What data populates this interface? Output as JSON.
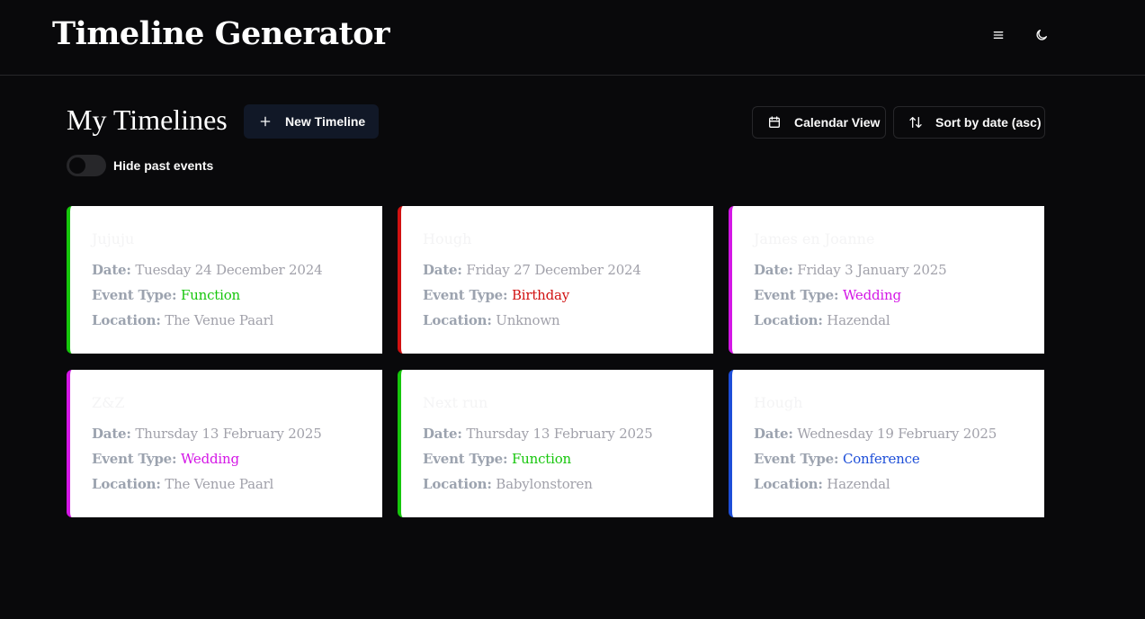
{
  "app": {
    "title": "Timeline Generator"
  },
  "header": {
    "menu_icon": "menu-icon",
    "theme_icon": "moon-icon"
  },
  "main": {
    "title": "My Timelines",
    "new_timeline_label": "New Timeline",
    "calendar_view_label": "Calendar View",
    "sort_label": "Sort by date (asc)",
    "hide_past_label": "Hide past events",
    "hide_past_checked": false
  },
  "labels": {
    "date": "Date:",
    "event_type": "Event Type:",
    "location": "Location:"
  },
  "colors": {
    "Function": "#16c60c",
    "Birthday": "#d11111",
    "Wedding": "#d417e6",
    "Conference": "#1d4ed8"
  },
  "cards": [
    {
      "title": "Jujuju",
      "date": "Tuesday 24 December 2024",
      "event_type": "Function",
      "location": "The Venue Paarl",
      "color": "#16c60c"
    },
    {
      "title": "Hough",
      "date": "Friday 27 December 2024",
      "event_type": "Birthday",
      "location": "Unknown",
      "color": "#d11111"
    },
    {
      "title": "James en Joanne",
      "date": "Friday 3 January 2025",
      "event_type": "Wedding",
      "location": "Hazendal",
      "color": "#d417e6"
    },
    {
      "title": "Z&Z",
      "date": "Thursday 13 February 2025",
      "event_type": "Wedding",
      "location": "The Venue Paarl",
      "color": "#d417e6"
    },
    {
      "title": "Next run",
      "date": "Thursday 13 February 2025",
      "event_type": "Function",
      "location": "Babylonstoren",
      "color": "#16c60c"
    },
    {
      "title": "Hough",
      "date": "Wednesday 19 February 2025",
      "event_type": "Conference",
      "location": "Hazendal",
      "color": "#1d4ed8"
    }
  ]
}
